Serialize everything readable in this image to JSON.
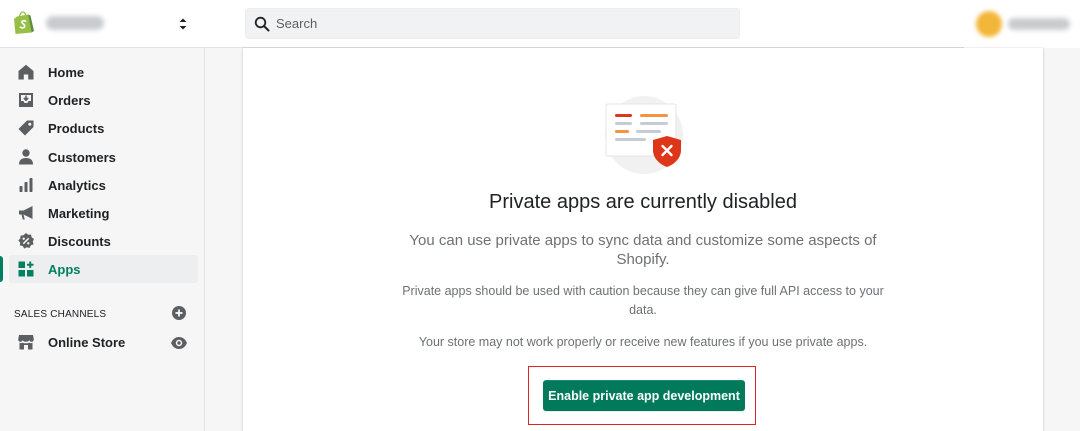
{
  "header": {
    "search_placeholder": "Search"
  },
  "sidebar": {
    "items": [
      {
        "label": "Home",
        "icon": "home-icon"
      },
      {
        "label": "Orders",
        "icon": "orders-icon"
      },
      {
        "label": "Products",
        "icon": "tag-icon"
      },
      {
        "label": "Customers",
        "icon": "person-icon"
      },
      {
        "label": "Analytics",
        "icon": "bar-chart-icon"
      },
      {
        "label": "Marketing",
        "icon": "megaphone-icon"
      },
      {
        "label": "Discounts",
        "icon": "discount-icon"
      },
      {
        "label": "Apps",
        "icon": "apps-icon",
        "active": true
      }
    ],
    "sales_channels_title": "SALES CHANNELS",
    "channels": [
      {
        "label": "Online Store",
        "icon": "store-icon"
      }
    ]
  },
  "main": {
    "heading": "Private apps are currently disabled",
    "subheading": "You can use private apps to sync data and customize some aspects of Shopify.",
    "body_1": "Private apps should be used with caution because they can give full API access to your data.",
    "body_2": "Your store may not work properly or receive new features if you use private apps.",
    "button_label": "Enable private app development"
  },
  "colors": {
    "accent": "#008060",
    "active_text": "#007f5f",
    "highlight_border": "#e02424"
  }
}
